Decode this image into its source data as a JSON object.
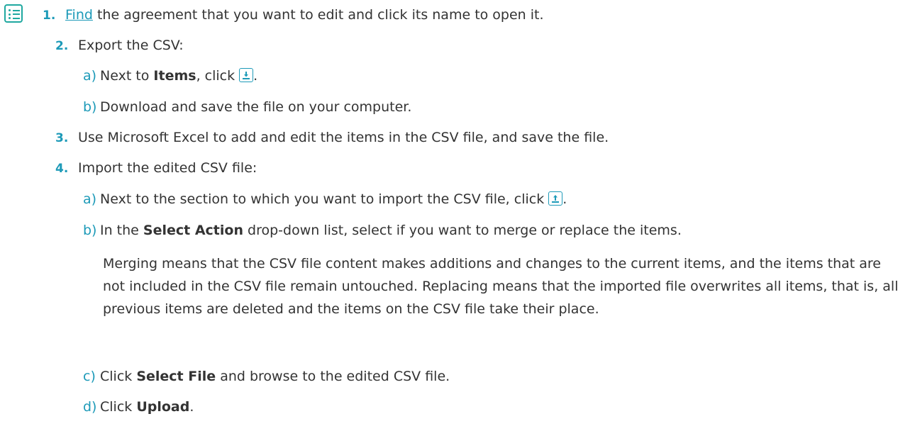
{
  "icons": {
    "steps": "list-steps-icon",
    "export": "download-icon",
    "import": "upload-icon"
  },
  "colors": {
    "accent": "#1d9ab8",
    "icon_border": "#1fa8a0",
    "text": "#333333"
  },
  "step1": {
    "number": "1.",
    "link": "Find",
    "text": " the agreement that you want to edit and click its name to open it."
  },
  "step2": {
    "number": "2.",
    "text": "Export the CSV:",
    "a": {
      "letter": "a)",
      "text_before": "Next to ",
      "bold": "Items",
      "text_after": ", click ",
      "text_end": "."
    },
    "b": {
      "letter": "b)",
      "text": "Download and save the file on your computer."
    }
  },
  "step3": {
    "number": "3.",
    "text": "Use Microsoft Excel to add and edit the items in the CSV file, and save the file."
  },
  "step4": {
    "number": "4.",
    "text": "Import the edited CSV file:",
    "a": {
      "letter": "a)",
      "text": "Next to the section to which you want to import the CSV file, click ",
      "text_end": "."
    },
    "b": {
      "letter": "b)",
      "text_before": "In the ",
      "bold": "Select Action",
      "text_after": " drop-down list, select if you want to merge or replace the items.",
      "paragraph": "Merging means that the CSV file content makes additions and changes to the current items, and the items that are not included in the CSV file remain untouched. Replacing means that the imported file overwrites all items, that is, all previous items are deleted and the items on the CSV file take their place."
    },
    "c": {
      "letter": "c)",
      "text_before": "Click ",
      "bold": "Select File",
      "text_after": " and browse to the edited CSV file."
    },
    "d": {
      "letter": "d)",
      "text_before": "Click ",
      "bold": "Upload",
      "text_after": "."
    }
  }
}
